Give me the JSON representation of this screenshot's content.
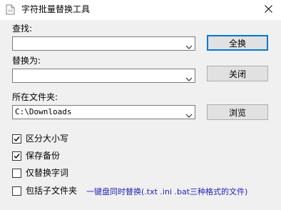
{
  "window": {
    "title": "字符批量替换工具"
  },
  "find": {
    "label": "查找:",
    "value": ""
  },
  "replace": {
    "label": "替换为:",
    "value": ""
  },
  "folder": {
    "label": "所在文件夹:",
    "value": "C:\\Downloads"
  },
  "buttons": {
    "replace_all": "全换",
    "close": "关闭",
    "browse": "浏览"
  },
  "options": [
    {
      "label": "区分大小写",
      "checked": true
    },
    {
      "label": "保存备份",
      "checked": true
    },
    {
      "label": "仅替换字词",
      "checked": false
    },
    {
      "label": "包括子文件夹",
      "checked": false
    }
  ],
  "note": "一键盘同时替换(.txt .ini .bat三种格式的文件)",
  "colors": {
    "accent": "#0078d7",
    "note_text": "#1f1fbf",
    "background": "#f0f0f0"
  },
  "icons": {
    "app": "document-icon",
    "close": "close-icon",
    "dropdown": "chevron-down-icon",
    "check": "checkmark-icon"
  }
}
